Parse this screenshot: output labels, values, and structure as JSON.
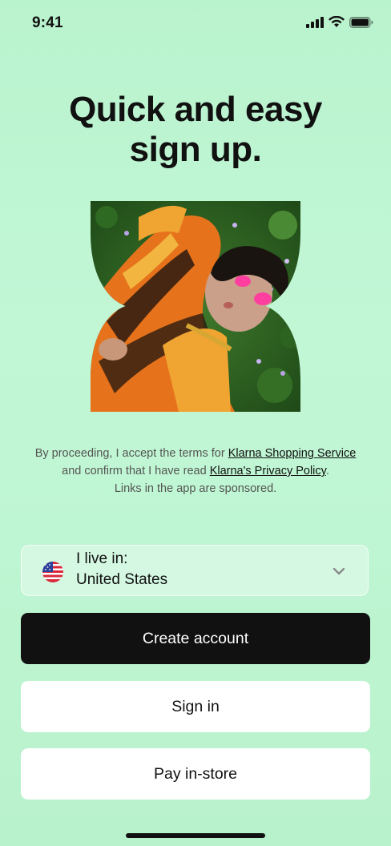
{
  "status_bar": {
    "time": "9:41",
    "icons": [
      "cellular-signal-icon",
      "wifi-icon",
      "battery-icon"
    ]
  },
  "headline": {
    "line1": "Quick and easy",
    "line2": "sign up."
  },
  "hero": {
    "icon": "klarna-shaped-photo"
  },
  "terms": {
    "part1": "By proceeding, I accept the terms for ",
    "link1": "Klarna Shopping Service",
    "part2": " and confirm that I have read ",
    "link2": "Klarna's Privacy Policy",
    "part3": ".",
    "sponsored": "Links in the app are sponsored."
  },
  "country_select": {
    "label": "I live in:",
    "value": "United States",
    "flag_icon": "us-flag-icon",
    "chevron_icon": "chevron-down-icon"
  },
  "buttons": {
    "create_account": "Create account",
    "sign_in": "Sign in",
    "pay_in_store": "Pay in-store"
  },
  "colors": {
    "background": "#bff5d3",
    "primary_button": "#111111",
    "secondary_button": "#ffffff"
  }
}
